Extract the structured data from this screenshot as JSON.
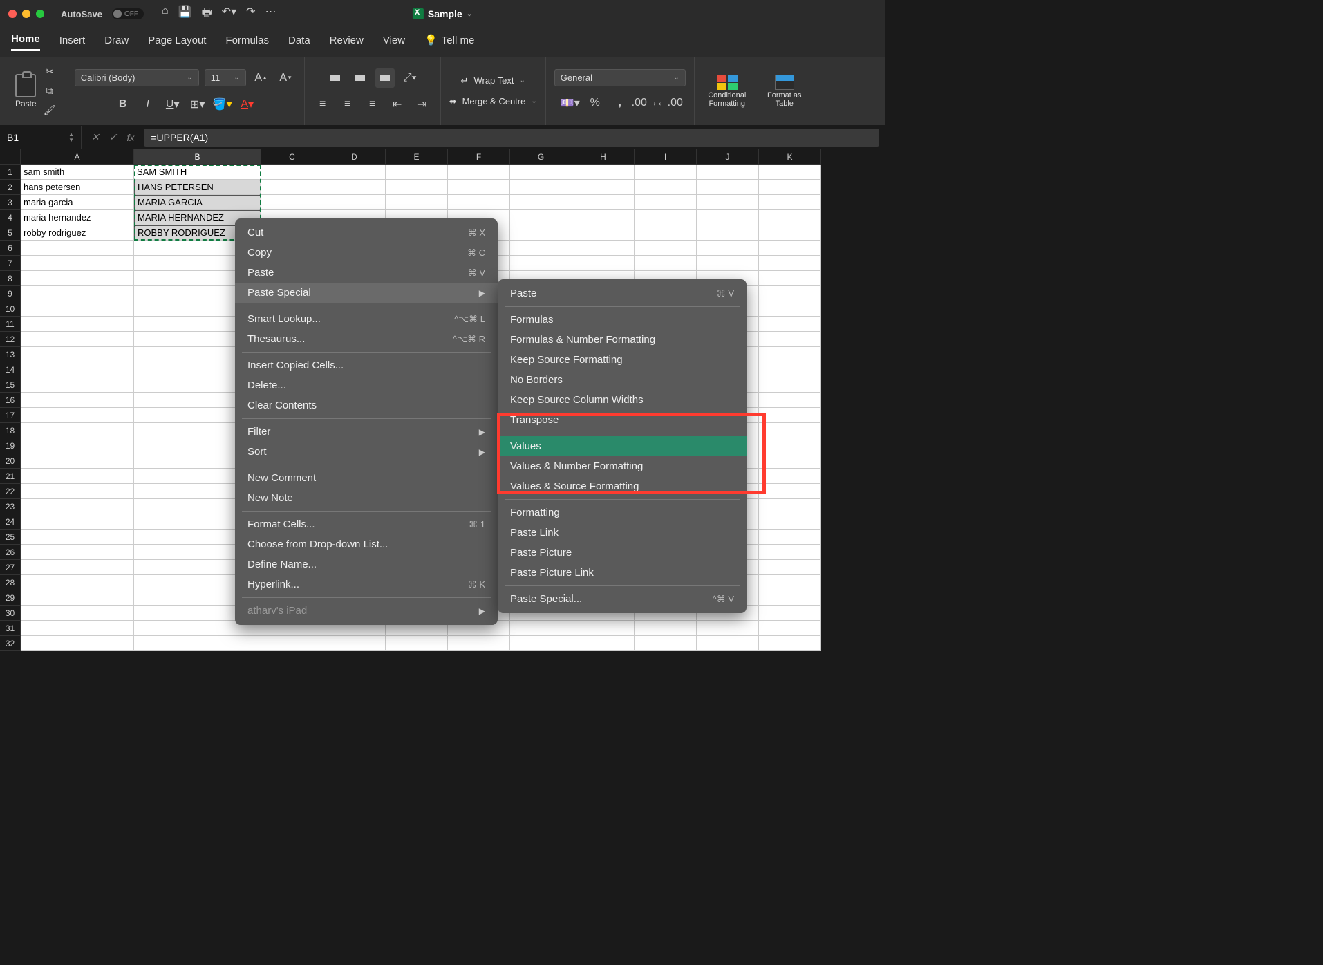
{
  "title_bar": {
    "autosave_label": "AutoSave",
    "autosave_state": "OFF",
    "doc_name": "Sample"
  },
  "tabs": {
    "items": [
      "Home",
      "Insert",
      "Draw",
      "Page Layout",
      "Formulas",
      "Data",
      "Review",
      "View"
    ],
    "tell_me": "Tell me",
    "active_index": 0
  },
  "ribbon": {
    "paste_label": "Paste",
    "font_name": "Calibri (Body)",
    "font_size": "11",
    "wrap_text": "Wrap Text",
    "merge_centre": "Merge & Centre",
    "number_format": "General",
    "conditional_formatting": "Conditional Formatting",
    "format_as_table": "Format as Table"
  },
  "formula_bar": {
    "cell_ref": "B1",
    "formula": "=UPPER(A1)"
  },
  "columns": [
    "A",
    "B",
    "C",
    "D",
    "E",
    "F",
    "G",
    "H",
    "I",
    "J",
    "K"
  ],
  "row_count": 32,
  "cells": {
    "A": [
      "sam smith",
      "hans petersen",
      "maria garcia",
      "maria hernandez",
      "robby rodriguez"
    ],
    "B": [
      "SAM SMITH",
      "HANS PETERSEN",
      "MARIA GARCIA",
      "MARIA HERNANDEZ",
      "ROBBY RODRIGUEZ"
    ]
  },
  "context_menu": {
    "items": [
      {
        "label": "Cut",
        "shortcut": "⌘ X"
      },
      {
        "label": "Copy",
        "shortcut": "⌘ C"
      },
      {
        "label": "Paste",
        "shortcut": "⌘ V"
      },
      {
        "label": "Paste Special",
        "submenu": true,
        "highlighted": true
      },
      {
        "sep": true
      },
      {
        "label": "Smart Lookup...",
        "shortcut": "^⌥⌘ L"
      },
      {
        "label": "Thesaurus...",
        "shortcut": "^⌥⌘ R"
      },
      {
        "sep": true
      },
      {
        "label": "Insert Copied Cells..."
      },
      {
        "label": "Delete..."
      },
      {
        "label": "Clear Contents"
      },
      {
        "sep": true
      },
      {
        "label": "Filter",
        "submenu": true
      },
      {
        "label": "Sort",
        "submenu": true
      },
      {
        "sep": true
      },
      {
        "label": "New Comment"
      },
      {
        "label": "New Note"
      },
      {
        "sep": true
      },
      {
        "label": "Format Cells...",
        "shortcut": "⌘ 1"
      },
      {
        "label": "Choose from Drop-down List..."
      },
      {
        "label": "Define Name..."
      },
      {
        "label": "Hyperlink...",
        "shortcut": "⌘ K"
      },
      {
        "sep": true
      },
      {
        "label": "atharv's iPad",
        "faded": true,
        "submenu": true
      }
    ],
    "submenu": [
      {
        "label": "Paste",
        "shortcut": "⌘ V"
      },
      {
        "sep": true
      },
      {
        "label": "Formulas"
      },
      {
        "label": "Formulas & Number Formatting"
      },
      {
        "label": "Keep Source Formatting"
      },
      {
        "label": "No Borders"
      },
      {
        "label": "Keep Source Column Widths"
      },
      {
        "label": "Transpose"
      },
      {
        "sep": true
      },
      {
        "label": "Values",
        "highlighted": true
      },
      {
        "label": "Values & Number Formatting"
      },
      {
        "label": "Values & Source Formatting"
      },
      {
        "sep": true
      },
      {
        "label": "Formatting"
      },
      {
        "label": "Paste Link"
      },
      {
        "label": "Paste Picture"
      },
      {
        "label": "Paste Picture Link"
      },
      {
        "sep": true
      },
      {
        "label": "Paste Special...",
        "shortcut": "^⌘ V"
      }
    ]
  }
}
